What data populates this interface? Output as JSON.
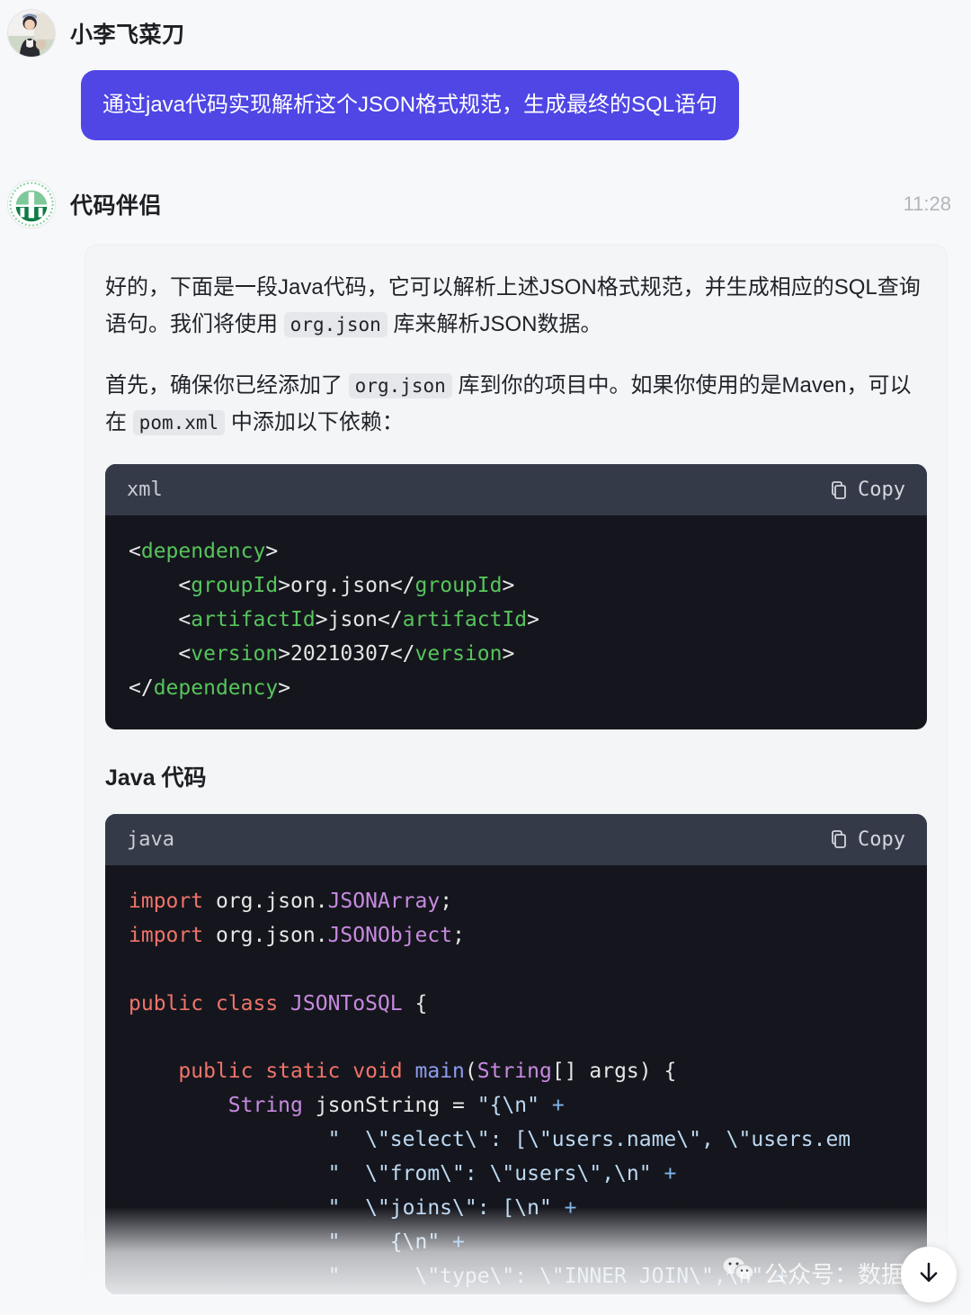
{
  "user": {
    "name": "小李飞菜刀",
    "avatar_icon": "user-photo-avatar",
    "message": "通过java代码实现解析这个JSON格式规范，生成最终的SQL语句"
  },
  "assistant": {
    "name": "代码伴侣",
    "avatar_icon": "green-logo-avatar",
    "timestamp": "11:28",
    "paragraph1": {
      "part1": "好的，下面是一段Java代码，它可以解析上述JSON格式规范，并生成相应的SQL查询语句。我们将使用 ",
      "code1": "org.json",
      "part2": " 库来解析JSON数据。"
    },
    "paragraph2": {
      "part1": "首先，确保你已经添加了 ",
      "code1": "org.json",
      "part2": " 库到你的项目中。如果你使用的是Maven，可以在 ",
      "code2": "pom.xml",
      "part3": " 中添加以下依赖："
    },
    "section_heading": "Java 代码"
  },
  "code_blocks": [
    {
      "language": "xml",
      "copy_label": "Copy",
      "copy_icon": "copy-icon",
      "lines": [
        [
          {
            "t": "<",
            "c": "punc"
          },
          {
            "t": "dependency",
            "c": "tag"
          },
          {
            "t": ">",
            "c": "punc"
          }
        ],
        [
          {
            "t": "    <",
            "c": "punc"
          },
          {
            "t": "groupId",
            "c": "tag"
          },
          {
            "t": ">",
            "c": "punc"
          },
          {
            "t": "org.json",
            "c": "txt"
          },
          {
            "t": "</",
            "c": "punc"
          },
          {
            "t": "groupId",
            "c": "tag"
          },
          {
            "t": ">",
            "c": "punc"
          }
        ],
        [
          {
            "t": "    <",
            "c": "punc"
          },
          {
            "t": "artifactId",
            "c": "tag"
          },
          {
            "t": ">",
            "c": "punc"
          },
          {
            "t": "json",
            "c": "txt"
          },
          {
            "t": "</",
            "c": "punc"
          },
          {
            "t": "artifactId",
            "c": "tag"
          },
          {
            "t": ">",
            "c": "punc"
          }
        ],
        [
          {
            "t": "    <",
            "c": "punc"
          },
          {
            "t": "version",
            "c": "tag"
          },
          {
            "t": ">",
            "c": "punc"
          },
          {
            "t": "20210307",
            "c": "txt"
          },
          {
            "t": "</",
            "c": "punc"
          },
          {
            "t": "version",
            "c": "tag"
          },
          {
            "t": ">",
            "c": "punc"
          }
        ],
        [
          {
            "t": "</",
            "c": "punc"
          },
          {
            "t": "dependency",
            "c": "tag"
          },
          {
            "t": ">",
            "c": "punc"
          }
        ]
      ]
    },
    {
      "language": "java",
      "copy_label": "Copy",
      "copy_icon": "copy-icon",
      "lines": [
        [
          {
            "t": "import",
            "c": "kw"
          },
          {
            "t": " org.json.",
            "c": "plain"
          },
          {
            "t": "JSONArray",
            "c": "type"
          },
          {
            "t": ";",
            "c": "plain"
          }
        ],
        [
          {
            "t": "import",
            "c": "kw"
          },
          {
            "t": " org.json.",
            "c": "plain"
          },
          {
            "t": "JSONObject",
            "c": "type"
          },
          {
            "t": ";",
            "c": "plain"
          }
        ],
        [
          {
            "t": " ",
            "c": "plain"
          }
        ],
        [
          {
            "t": "public class",
            "c": "kw"
          },
          {
            "t": " ",
            "c": "plain"
          },
          {
            "t": "JSONToSQL",
            "c": "type"
          },
          {
            "t": " {",
            "c": "plain"
          }
        ],
        [
          {
            "t": " ",
            "c": "plain"
          }
        ],
        [
          {
            "t": "    ",
            "c": "plain"
          },
          {
            "t": "public static void",
            "c": "kw"
          },
          {
            "t": " ",
            "c": "plain"
          },
          {
            "t": "main",
            "c": "fn"
          },
          {
            "t": "(",
            "c": "plain"
          },
          {
            "t": "String",
            "c": "type"
          },
          {
            "t": "[] args) {",
            "c": "plain"
          }
        ],
        [
          {
            "t": "        ",
            "c": "plain"
          },
          {
            "t": "String",
            "c": "type"
          },
          {
            "t": " jsonString = ",
            "c": "plain"
          },
          {
            "t": "\"{\\n\"",
            "c": "str"
          },
          {
            "t": " +",
            "c": "op"
          }
        ],
        [
          {
            "t": "                ",
            "c": "plain"
          },
          {
            "t": "\"  \\\"select\\\": [\\\"users.name\\\", \\\"users.em",
            "c": "str"
          }
        ],
        [
          {
            "t": "                ",
            "c": "plain"
          },
          {
            "t": "\"  \\\"from\\\": \\\"users\\\",\\n\"",
            "c": "str"
          },
          {
            "t": " +",
            "c": "op"
          }
        ],
        [
          {
            "t": "                ",
            "c": "plain"
          },
          {
            "t": "\"  \\\"joins\\\": [\\n\"",
            "c": "str"
          },
          {
            "t": " +",
            "c": "op"
          }
        ],
        [
          {
            "t": "                ",
            "c": "plain"
          },
          {
            "t": "\"    {\\n\"",
            "c": "str"
          },
          {
            "t": " +",
            "c": "op"
          }
        ],
        [
          {
            "t": "                ",
            "c": "plain"
          },
          {
            "t": "\"      \\\"type\\\": \\\"INNER JOIN\\\",\\n\"",
            "c": "str"
          },
          {
            "t": " +",
            "c": "op"
          }
        ]
      ]
    }
  ],
  "overlays": {
    "watermark_text": "公众号：数据黑",
    "watermark_icon": "wechat-icon",
    "scroll_button_icon": "arrow-down-icon"
  },
  "colors": {
    "user_bubble": "#4f46e5",
    "code_background": "#15161d",
    "code_header": "#343a47",
    "page_background": "#f7f8fa",
    "brand_green": "#1f9d55"
  }
}
